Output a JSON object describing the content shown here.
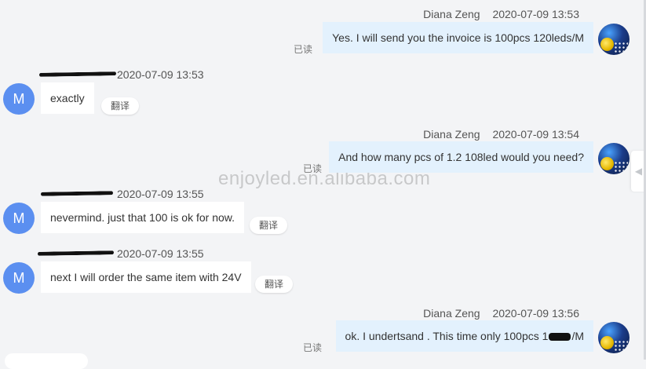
{
  "watermark": "enjoyled.en.alibaba.com",
  "translate_label": "翻译",
  "read_label": "已读",
  "messages": [
    {
      "sender": "Diana Zeng",
      "time": "2020-07-09 13:53",
      "text": "Yes. I will send you the invoice is 100pcs 120leds/M",
      "direction": "out"
    },
    {
      "time": "2020-07-09 13:53",
      "text": "exactly",
      "direction": "in",
      "avatar": "M"
    },
    {
      "sender": "Diana Zeng",
      "time": "2020-07-09 13:54",
      "text": "And how many pcs of 1.2 108led would you need?",
      "direction": "out"
    },
    {
      "time": "2020-07-09 13:55",
      "text": "nevermind. just that 100 is ok for now.",
      "direction": "in",
      "avatar": "M"
    },
    {
      "time": "2020-07-09 13:55",
      "text": "next I will order the same item with 24V",
      "direction": "in",
      "avatar": "M"
    },
    {
      "sender": "Diana Zeng",
      "time": "2020-07-09 13:56",
      "text": "ok. I undertsand . This time only 100pcs 1",
      "text_tail": "/M",
      "direction": "out"
    }
  ],
  "colors": {
    "outgoing_bubble": "#e3f1fd",
    "incoming_bubble": "#ffffff",
    "avatar_m": "#5b8ff0",
    "background": "#f3f4f6"
  },
  "icons": {
    "collapse": "chevron-left-icon"
  }
}
